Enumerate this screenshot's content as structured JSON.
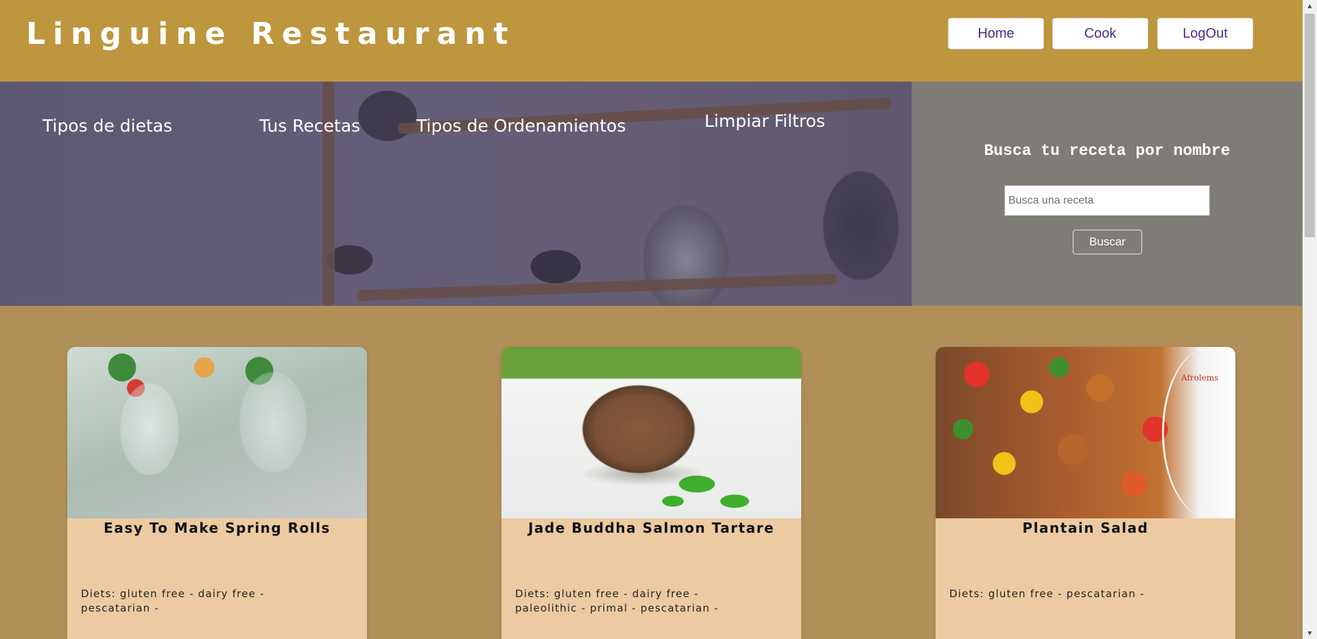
{
  "header": {
    "brand": "Linguine Restaurant",
    "nav": {
      "home": "Home",
      "cook": "Cook",
      "logout": "LogOut"
    },
    "colors": {
      "bar": "#bd963d",
      "button_text": "#4b2a85"
    }
  },
  "filters": {
    "diets": "Tipos de dietas",
    "recipes": "Tus Recetas",
    "order": "Tipos de Ordenamientos",
    "clear": "Limpiar Filtros"
  },
  "search": {
    "title": "Busca tu receta por nombre",
    "placeholder": "Busca una receta",
    "value": "",
    "button": "Buscar"
  },
  "cards": [
    {
      "title": "Easy To Make Spring Rolls",
      "diets": "Diets: gluten free - dairy free - pescatarian -",
      "image": "spring-rolls-photo"
    },
    {
      "title": "Jade Buddha Salmon Tartare",
      "diets": "Diets: gluten free - dairy free - paleolithic - primal - pescatarian -",
      "image": "salmon-tartare-photo"
    },
    {
      "title": "Plantain Salad",
      "diets": "Diets: gluten free - pescatarian -",
      "image": "plantain-salad-photo",
      "watermark": "Afrolems"
    }
  ],
  "scrollbar": {
    "up_icon": "arrow-up-icon",
    "down_icon": "arrow-down-icon"
  }
}
